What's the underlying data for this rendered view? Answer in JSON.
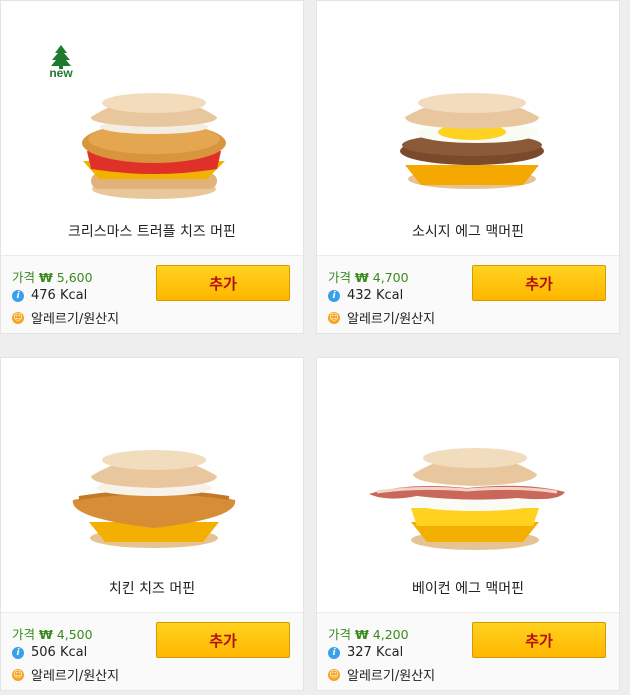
{
  "labels": {
    "price_prefix": "가격",
    "currency": "₩",
    "add_button": "추가",
    "allergen_link": "알레르기/원산지",
    "new_badge": "new"
  },
  "products": [
    {
      "name": "크리스마스 트러플 치즈 머핀",
      "price": "5,600",
      "kcal": "476 Kcal",
      "is_new": true
    },
    {
      "name": "소시지 에그 맥머핀",
      "price": "4,700",
      "kcal": "432 Kcal",
      "is_new": false
    },
    {
      "name": "치킨 치즈 머핀",
      "price": "4,500",
      "kcal": "506 Kcal",
      "is_new": false
    },
    {
      "name": "베이컨 에그 맥머핀",
      "price": "4,200",
      "kcal": "327 Kcal",
      "is_new": false
    }
  ],
  "colors": {
    "price_green": "#3a8a1e",
    "button_yellow": "#ffc60b",
    "button_text_red": "#b01010",
    "info_blue": "#3aa0e8",
    "allergy_orange": "#f5a623"
  }
}
